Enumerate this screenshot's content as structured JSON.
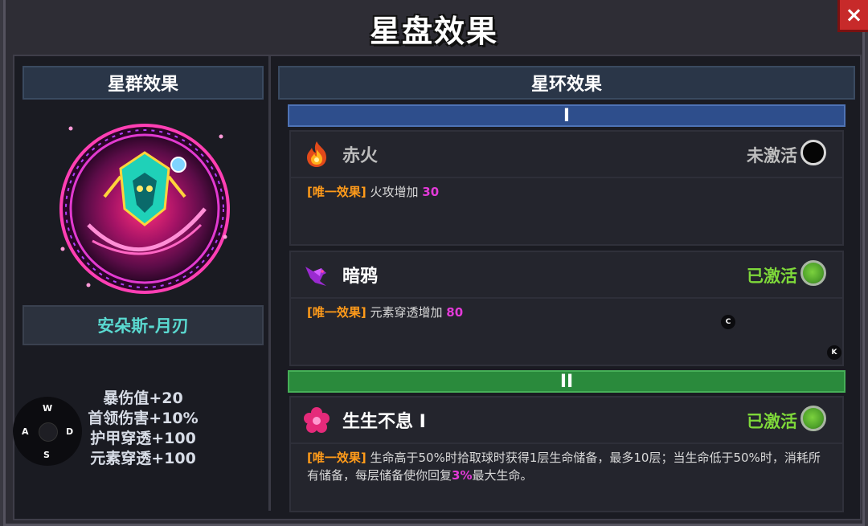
{
  "window": {
    "title": "星盘效果",
    "close_icon": "×"
  },
  "left": {
    "header": "星群效果",
    "constellation_name": "安朵斯-月刃",
    "stats": [
      "暴伤值+20",
      "首领伤害+10%",
      "护甲穿透+100",
      "元素穿透+100"
    ]
  },
  "joystick": {
    "up": "W",
    "left": "A",
    "right": "D",
    "down": "S"
  },
  "right": {
    "header": "星环效果",
    "tiers": [
      {
        "label": "I",
        "cards": [
          {
            "name": "赤火",
            "icon": "fire-icon",
            "status": "未激活",
            "active": false,
            "tag": "[唯一效果]",
            "text_before": "火攻增加",
            "highlight": "30",
            "text_after": ""
          },
          {
            "name": "暗鸦",
            "icon": "crow-icon",
            "status": "已激活",
            "active": true,
            "tag": "[唯一效果]",
            "text_before": "元素穿透增加",
            "highlight": "80",
            "text_after": ""
          }
        ]
      },
      {
        "label": "II",
        "cards": [
          {
            "name": "生生不息 I",
            "icon": "flower-icon",
            "status": "已激活",
            "active": true,
            "tag": "[唯一效果]",
            "text_before": "生命高于50%时拾取球时获得1层生命储备，最多10层；当生命低于50%时，消耗所有储备，每层储备使你回复",
            "highlight": "3%",
            "text_after": "最大生命。"
          }
        ]
      }
    ]
  },
  "hotkeys": {
    "c": "C",
    "k": "K"
  },
  "colors": {
    "inactive_status": "#bdbdbd",
    "active_status": "#7ed83a",
    "tag": "#ff9b1a",
    "highlight": "#e33ad8",
    "constellation_name": "#5ad9d0"
  }
}
